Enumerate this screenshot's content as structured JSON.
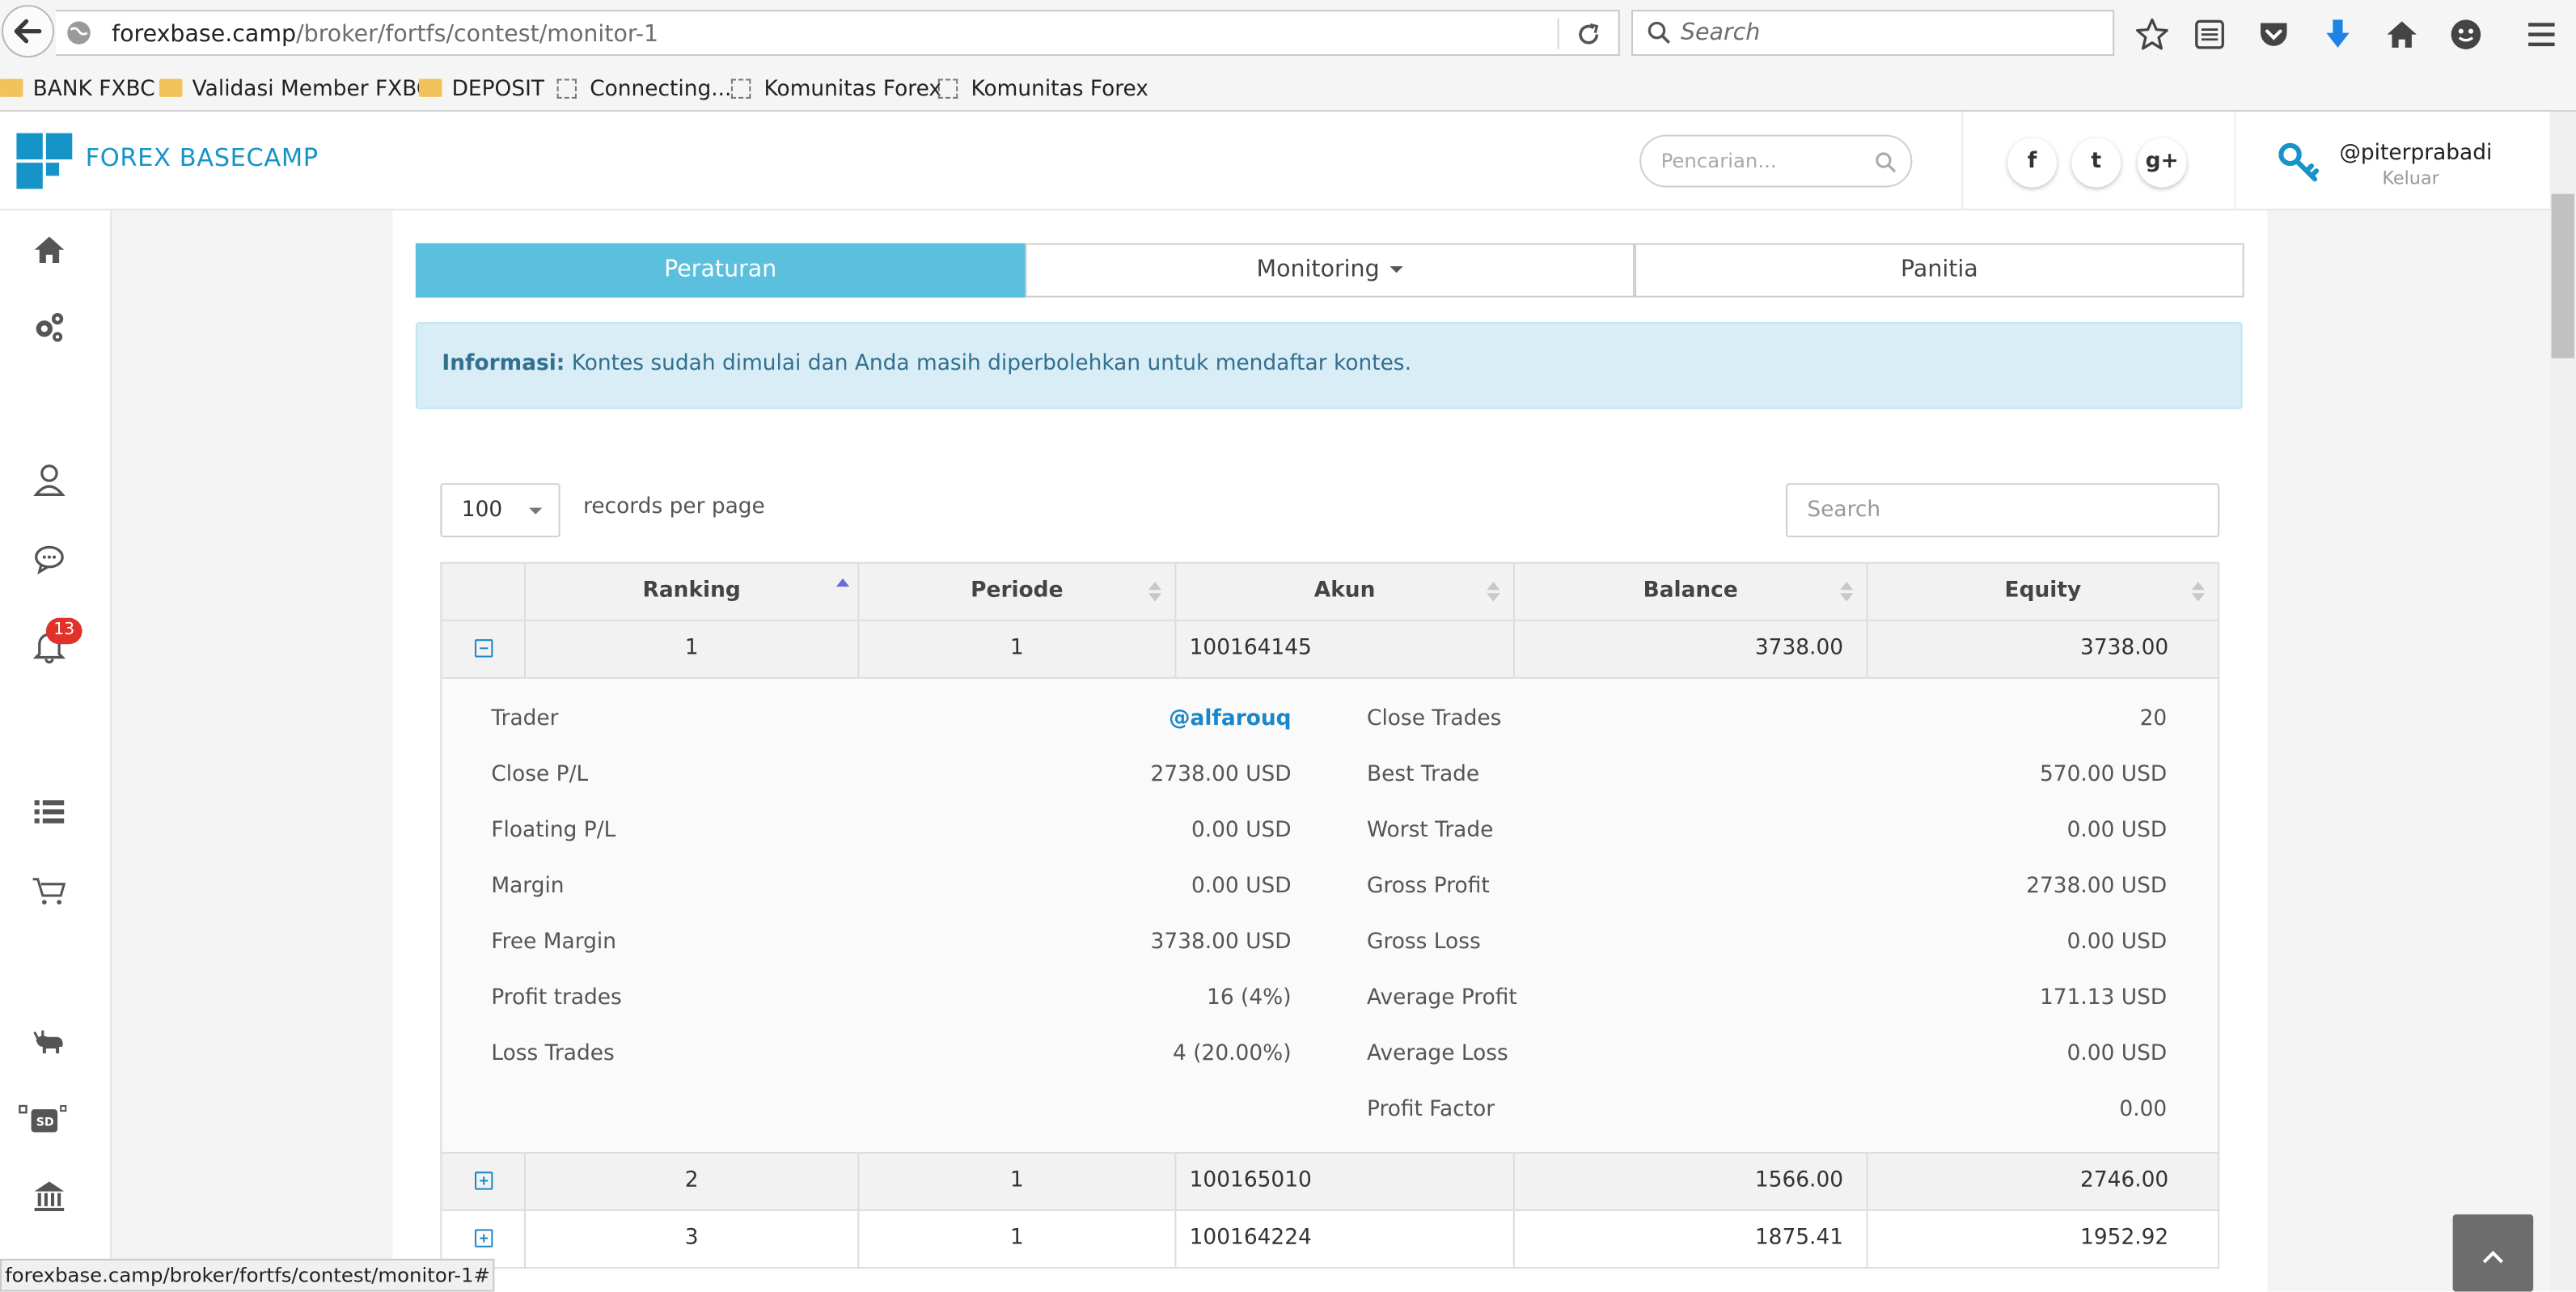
{
  "browser": {
    "url_domain": "forexbase.camp",
    "url_path": "/broker/fortfs/contest/monitor-1",
    "search_placeholder": "Search",
    "bookmarks": [
      "BANK FXBC",
      "Validasi Member FXBC",
      "DEPOSIT",
      "Connecting...",
      "Komunitas Forex",
      "Komunitas Forex"
    ],
    "status_url": "forexbase.camp/broker/fortfs/contest/monitor-1#"
  },
  "header": {
    "brand": "FOREX BASECAMP",
    "search_placeholder": "Pencarian...",
    "social": [
      "f",
      "t",
      "g+"
    ],
    "username": "@piterprabadi",
    "logout": "Keluar"
  },
  "sidebar": {
    "notification_count": "13",
    "icons": [
      "home-icon",
      "gears-icon",
      "user-icon",
      "chat-icon",
      "bell-icon",
      "list-icon",
      "cart-icon",
      "bull-icon",
      "sd-card-icon",
      "bank-icon"
    ]
  },
  "tabs": [
    "Peraturan",
    "Monitoring",
    "Panitia"
  ],
  "alert": {
    "label": "Informasi:",
    "text": " Kontes sudah dimulai dan Anda masih diperbolehkan untuk mendaftar kontes."
  },
  "table_controls": {
    "per_page_value": "100",
    "per_page_label": "records per page",
    "search_placeholder": "Search"
  },
  "table": {
    "columns": [
      "Ranking",
      "Periode",
      "Akun",
      "Balance",
      "Equity"
    ],
    "rows": [
      {
        "ranking": "1",
        "periode": "1",
        "akun": "100164145",
        "balance": "3738.00",
        "equity": "3738.00",
        "expanded": true
      },
      {
        "ranking": "2",
        "periode": "1",
        "akun": "100165010",
        "balance": "1566.00",
        "equity": "2746.00",
        "expanded": false
      },
      {
        "ranking": "3",
        "periode": "1",
        "akun": "100164224",
        "balance": "1875.41",
        "equity": "1952.92",
        "expanded": false
      }
    ],
    "detail": {
      "left": [
        {
          "label": "Trader",
          "value": "@alfarouq"
        },
        {
          "label": "Close P/L",
          "value": "2738.00 USD"
        },
        {
          "label": "Floating P/L",
          "value": "0.00 USD"
        },
        {
          "label": "Margin",
          "value": "0.00 USD"
        },
        {
          "label": "Free Margin",
          "value": "3738.00 USD"
        },
        {
          "label": "Profit trades",
          "value": "16 (4%)"
        },
        {
          "label": "Loss Trades",
          "value": "4 (20.00%)"
        }
      ],
      "right": [
        {
          "label": "Close Trades",
          "value": "20"
        },
        {
          "label": "Best Trade",
          "value": "570.00 USD"
        },
        {
          "label": "Worst Trade",
          "value": "0.00 USD"
        },
        {
          "label": "Gross Profit",
          "value": "2738.00 USD"
        },
        {
          "label": "Gross Loss",
          "value": "0.00 USD"
        },
        {
          "label": "Average Profit",
          "value": "171.13 USD"
        },
        {
          "label": "Average Loss",
          "value": "0.00 USD"
        },
        {
          "label": "Profit Factor",
          "value": "0.00"
        }
      ]
    }
  },
  "colors": {
    "accent": "#5bc0de",
    "brand": "#1694c8",
    "link": "#1a87c8",
    "alert_bg": "#d9edf7",
    "alert_text": "#31708f",
    "badge": "#e0312a"
  }
}
